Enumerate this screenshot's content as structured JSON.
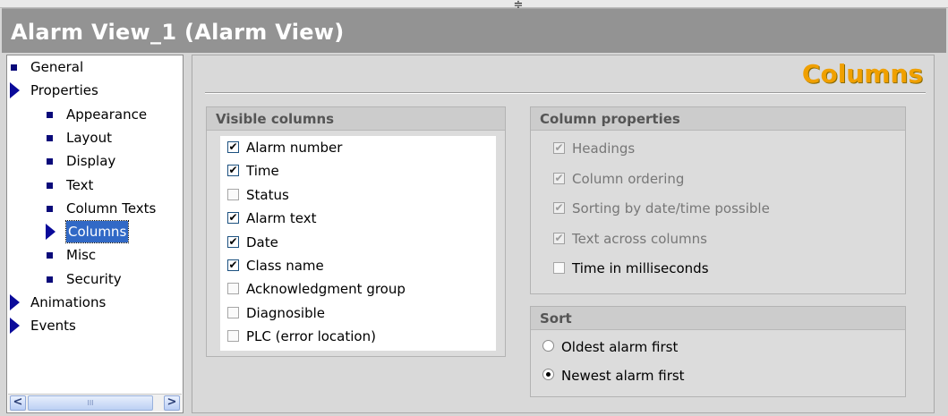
{
  "window": {
    "title": "Alarm View_1 (Alarm View)"
  },
  "tree": {
    "items": [
      {
        "label": "General",
        "level": 0,
        "marker": "bullet"
      },
      {
        "label": "Properties",
        "level": 0,
        "marker": "arrow"
      },
      {
        "label": "Appearance",
        "level": 1,
        "marker": "bullet"
      },
      {
        "label": "Layout",
        "level": 1,
        "marker": "bullet"
      },
      {
        "label": "Display",
        "level": 1,
        "marker": "bullet"
      },
      {
        "label": "Text",
        "level": 1,
        "marker": "bullet"
      },
      {
        "label": "Column Texts",
        "level": 1,
        "marker": "bullet"
      },
      {
        "label": "Columns",
        "level": 1,
        "marker": "arrow",
        "selected": true
      },
      {
        "label": "Misc",
        "level": 1,
        "marker": "bullet"
      },
      {
        "label": "Security",
        "level": 1,
        "marker": "bullet"
      },
      {
        "label": "Animations",
        "level": 0,
        "marker": "arrow"
      },
      {
        "label": "Events",
        "level": 0,
        "marker": "arrow"
      }
    ],
    "scroll_left": "<",
    "scroll_right": ">",
    "scroll_grip": "III"
  },
  "panel": {
    "heading": "Columns",
    "visible_columns": {
      "title": "Visible columns",
      "items": [
        {
          "label": "Alarm number",
          "checked": true
        },
        {
          "label": "Time",
          "checked": true
        },
        {
          "label": "Status",
          "checked": false
        },
        {
          "label": "Alarm text",
          "checked": true
        },
        {
          "label": "Date",
          "checked": true
        },
        {
          "label": "Class name",
          "checked": true
        },
        {
          "label": "Acknowledgment group",
          "checked": false
        },
        {
          "label": "Diagnosible",
          "checked": false
        },
        {
          "label": "PLC (error location)",
          "checked": false
        }
      ]
    },
    "column_properties": {
      "title": "Column properties",
      "items": [
        {
          "label": "Headings",
          "checked": true,
          "disabled": true
        },
        {
          "label": "Column ordering",
          "checked": true,
          "disabled": true
        },
        {
          "label": "Sorting by date/time possible",
          "checked": true,
          "disabled": true
        },
        {
          "label": "Text across columns",
          "checked": true,
          "disabled": true
        },
        {
          "label": "Time in milliseconds",
          "checked": false,
          "disabled": false
        }
      ]
    },
    "sort": {
      "title": "Sort",
      "options": [
        {
          "label": "Oldest alarm first",
          "selected": false
        },
        {
          "label": "Newest alarm first",
          "selected": true
        }
      ]
    }
  },
  "colors": {
    "title_bar": "#939393",
    "heading_accent": "#f0a000",
    "tree_marker": "#0a0a7a",
    "selection": "#3169c6"
  },
  "icons": {
    "checkmark": "✔",
    "splitter_grip": "≑"
  }
}
